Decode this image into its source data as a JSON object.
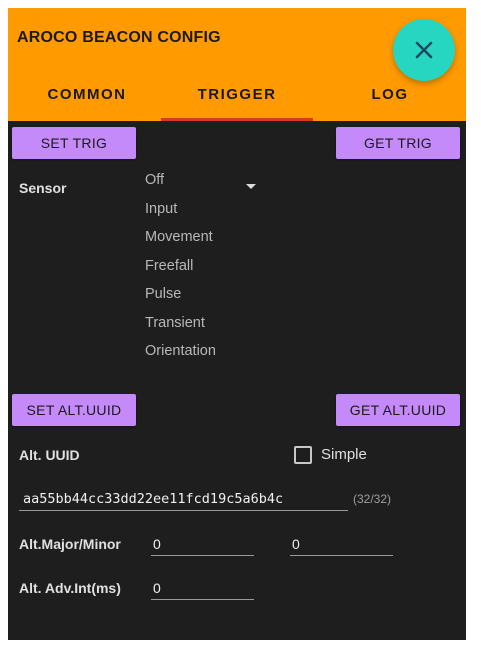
{
  "header": {
    "title": "AROCO BEACON CONFIG",
    "close_icon": "close-icon",
    "colors": {
      "header_bg": "#ff9a00",
      "fab_bg": "#26d6c0",
      "tab_indicator": "#d93a1e"
    }
  },
  "tabs": [
    {
      "label": "COMMON",
      "selected": false
    },
    {
      "label": "TRIGGER",
      "selected": true
    },
    {
      "label": "LOG",
      "selected": false
    }
  ],
  "trigger": {
    "set_label": "SET TRIG",
    "get_label": "GET TRIG",
    "sensor_label": "Sensor",
    "sensor_selected": "Off",
    "sensor_options": [
      "Off",
      "Input",
      "Movement",
      "Freefall",
      "Pulse",
      "Transient",
      "Orientation"
    ]
  },
  "alt_uuid": {
    "set_label": "SET ALT.UUID",
    "get_label": "GET ALT.UUID",
    "label": "Alt. UUID",
    "simple_label": "Simple",
    "simple_checked": false,
    "value": "aa55bb44cc33dd22ee11fcd19c5a6b4c",
    "counter": "(32/32)"
  },
  "alt_major_minor": {
    "label": "Alt.Major/Minor",
    "major": "0",
    "minor": "0"
  },
  "alt_adv": {
    "label": "Alt. Adv.Int(ms)",
    "value": "0"
  },
  "colors": {
    "button_bg": "#c58af9",
    "panel_bg": "#1e1e1e"
  }
}
